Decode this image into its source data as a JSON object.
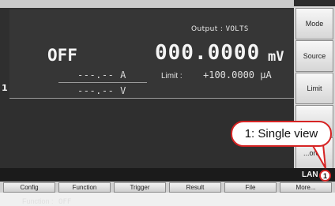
{
  "display": {
    "left_edge_label": "1",
    "output_label": "Output :",
    "output_mode": "VOLTS",
    "state": "OFF",
    "value": "000.0000",
    "value_unit": "mV",
    "reading_current": "---.-- A",
    "reading_voltage": "---.-- V",
    "limit_label": "Limit :",
    "limit_value": "+100.0000 µA",
    "function_label": "Function :",
    "function_value": "OFF"
  },
  "softkeys": [
    "Mode",
    "Source",
    "Limit",
    "",
    "...ore..."
  ],
  "status": {
    "lan": "LAN",
    "view_number": "1"
  },
  "bottom_keys": [
    "Config",
    "Function",
    "Trigger",
    "Result",
    "File",
    "More..."
  ],
  "callout": {
    "text": "1: Single view"
  },
  "colors": {
    "highlight": "#d62424",
    "screen_bg": "#2f2f2f",
    "text": "#f4f4f4"
  }
}
